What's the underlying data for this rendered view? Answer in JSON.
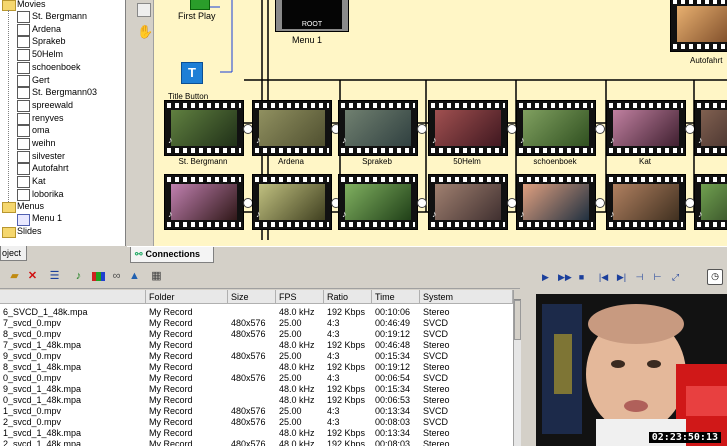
{
  "tree": {
    "root_label": "Movies",
    "movies": [
      "St. Bergmann",
      "Ardena",
      "Sprakeb",
      "50Helm",
      "schoenboek",
      "Gert",
      "St. Bergmann03",
      "spreewald",
      "renyves",
      "oma",
      "weihn",
      "silvester",
      "Autofahrt",
      "Kat",
      "loborika"
    ],
    "menus_label": "Menus",
    "menu_item": "Menu 1",
    "slides_label": "Slides",
    "tab_label": "oject"
  },
  "canvas": {
    "first_play": "First Play",
    "menu_node": "Menu 1",
    "root_label": "ROOT",
    "title_button_icon": "T",
    "title_button_label": "Title Button",
    "autofahrt_label": "Autofahrt",
    "row1_labels": [
      "St. Bergmann",
      "Ardena",
      "Sprakeb",
      "50Helm",
      "schoenboek",
      "Kat",
      "lo"
    ]
  },
  "tabs": {
    "connections": "Connections"
  },
  "list": {
    "columns": [
      "",
      "Folder",
      "Size",
      "FPS",
      "Ratio",
      "Time",
      "System"
    ],
    "rows": [
      [
        "6_SVCD_1_48k.mpa",
        "My Record",
        "",
        "48.0 kHz",
        "192 Kbps",
        "00:10:06",
        "Stereo"
      ],
      [
        "7_svcd_0.mpv",
        "My Record",
        "480x576",
        "25.00",
        "4:3",
        "00:46:49",
        "SVCD"
      ],
      [
        "8_svcd_0.mpv",
        "My Record",
        "480x576",
        "25.00",
        "4:3",
        "00:19:12",
        "SVCD"
      ],
      [
        "7_svcd_1_48k.mpa",
        "My Record",
        "",
        "48.0 kHz",
        "192 Kbps",
        "00:46:48",
        "Stereo"
      ],
      [
        "9_svcd_0.mpv",
        "My Record",
        "480x576",
        "25.00",
        "4:3",
        "00:15:34",
        "SVCD"
      ],
      [
        "8_svcd_1_48k.mpa",
        "My Record",
        "",
        "48.0 kHz",
        "192 Kbps",
        "00:19:12",
        "Stereo"
      ],
      [
        "0_svcd_0.mpv",
        "My Record",
        "480x576",
        "25.00",
        "4:3",
        "00:06:54",
        "SVCD"
      ],
      [
        "9_svcd_1_48k.mpa",
        "My Record",
        "",
        "48.0 kHz",
        "192 Kbps",
        "00:15:34",
        "Stereo"
      ],
      [
        "0_svcd_1_48k.mpa",
        "My Record",
        "",
        "48.0 kHz",
        "192 Kbps",
        "00:06:53",
        "Stereo"
      ],
      [
        "1_svcd_0.mpv",
        "My Record",
        "480x576",
        "25.00",
        "4:3",
        "00:13:34",
        "SVCD"
      ],
      [
        "2_svcd_0.mpv",
        "My Record",
        "480x576",
        "25.00",
        "4:3",
        "00:08:03",
        "SVCD"
      ],
      [
        "1_svcd_1_48k.mpa",
        "My Record",
        "",
        "48.0 kHz",
        "192 Kbps",
        "00:13:34",
        "Stereo"
      ],
      [
        "2_svcd_1_48k.mpa",
        "My Record",
        "480x576",
        "48.0 kHz",
        "192 Kbps",
        "00:08:03",
        "Stereo"
      ]
    ]
  },
  "preview": {
    "timecode": "02:23:50:13"
  },
  "colors": {
    "canvas_bg": "#fff6c6",
    "title_button": "#1e7fd6",
    "link_blue": "#1a3fd8"
  },
  "icons": [
    "folder-open-icon",
    "delete-icon",
    "sort-icon",
    "audio-video-icon",
    "color-bars-icon",
    "link-icon",
    "image-icon",
    "grid-icon",
    "play-icon",
    "fast-forward-icon",
    "stop-icon",
    "step-back-icon",
    "step-forward-icon",
    "mark-in-icon",
    "mark-out-icon",
    "fullscreen-icon",
    "clock-icon",
    "hand-icon",
    "music-note-icon"
  ]
}
